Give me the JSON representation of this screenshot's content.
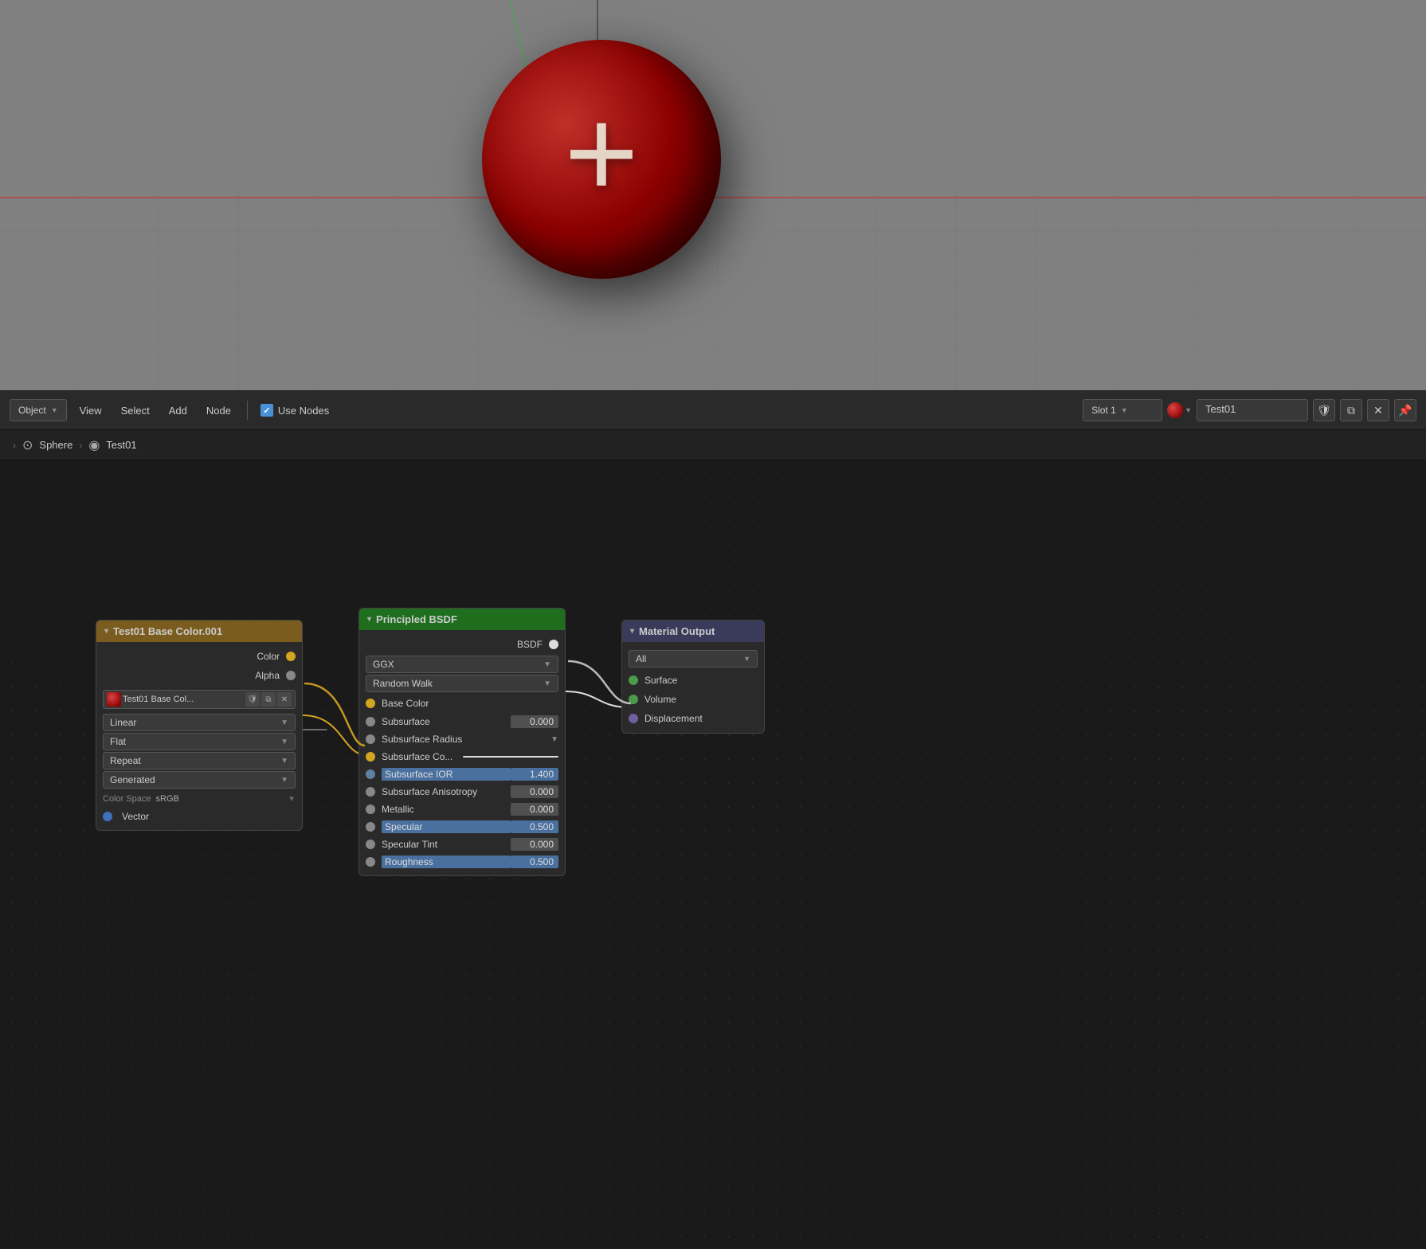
{
  "viewport": {
    "background_color": "#808080"
  },
  "toolbar": {
    "object_label": "Object",
    "view_label": "View",
    "select_label": "Select",
    "add_label": "Add",
    "node_label": "Node",
    "use_nodes_label": "Use Nodes",
    "slot_label": "Slot 1",
    "material_name": "Test01",
    "shield_icon": "🛡",
    "copy_icon": "📋",
    "close_icon": "✕",
    "pin_icon": "📌"
  },
  "breadcrumb": {
    "sphere_label": "Sphere",
    "test01_label": "Test01"
  },
  "nodes": {
    "texture_node": {
      "title": "Test01 Base Color.001",
      "color_label": "Color",
      "alpha_label": "Alpha",
      "image_name": "Test01 Base Col...",
      "interpolation": "Linear",
      "projection": "Flat",
      "extension": "Repeat",
      "source": "Generated",
      "color_space_label": "Color Space",
      "color_space_value": "sRGB",
      "vector_label": "Vector"
    },
    "bsdf_node": {
      "title": "Principled BSDF",
      "bsdf_label": "BSDF",
      "distribution": "GGX",
      "subsurface_method": "Random Walk",
      "base_color_label": "Base Color",
      "subsurface_label": "Subsurface",
      "subsurface_value": "0.000",
      "subsurface_radius_label": "Subsurface Radius",
      "subsurface_co_label": "Subsurface Co...",
      "subsurface_ior_label": "Subsurface IOR",
      "subsurface_ior_value": "1.400",
      "subsurface_anisotropy_label": "Subsurface Anisotropy",
      "subsurface_anisotropy_value": "0.000",
      "metallic_label": "Metallic",
      "metallic_value": "0.000",
      "specular_label": "Specular",
      "specular_value": "0.500",
      "specular_tint_label": "Specular Tint",
      "specular_tint_value": "0.000",
      "roughness_label": "Roughness",
      "roughness_value": "0.500"
    },
    "output_node": {
      "title": "Material Output",
      "target_label": "All",
      "surface_label": "Surface",
      "volume_label": "Volume",
      "displacement_label": "Displacement"
    }
  }
}
